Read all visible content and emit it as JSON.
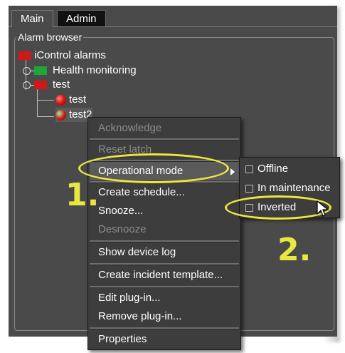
{
  "tabs": [
    "Main",
    "Admin"
  ],
  "panel_title": "Alarm browser",
  "tree": {
    "root": "iControl alarms",
    "health": "Health monitoring",
    "test_folder": "test",
    "test1": "test",
    "test2": "test2"
  },
  "context_menu": {
    "acknowledge": "Acknowledge",
    "reset_latch": "Reset latch",
    "operational_mode": "Operational mode",
    "create_schedule": "Create schedule...",
    "snooze": "Snooze...",
    "desnooze": "Desnooze",
    "show_device_log": "Show device log",
    "create_incident_template": "Create incident template...",
    "edit_plugin": "Edit plug-in...",
    "remove_plugin": "Remove plug-in...",
    "properties": "Properties"
  },
  "submenu": {
    "offline": "Offline",
    "in_maintenance": "In maintenance",
    "inverted": "Inverted"
  },
  "steps": {
    "one": "1.",
    "two": "2."
  },
  "colors": {
    "annotation": "#e8e840",
    "panel_bg": "#4a4a4a",
    "menu_bg": "#3d3d3d"
  }
}
